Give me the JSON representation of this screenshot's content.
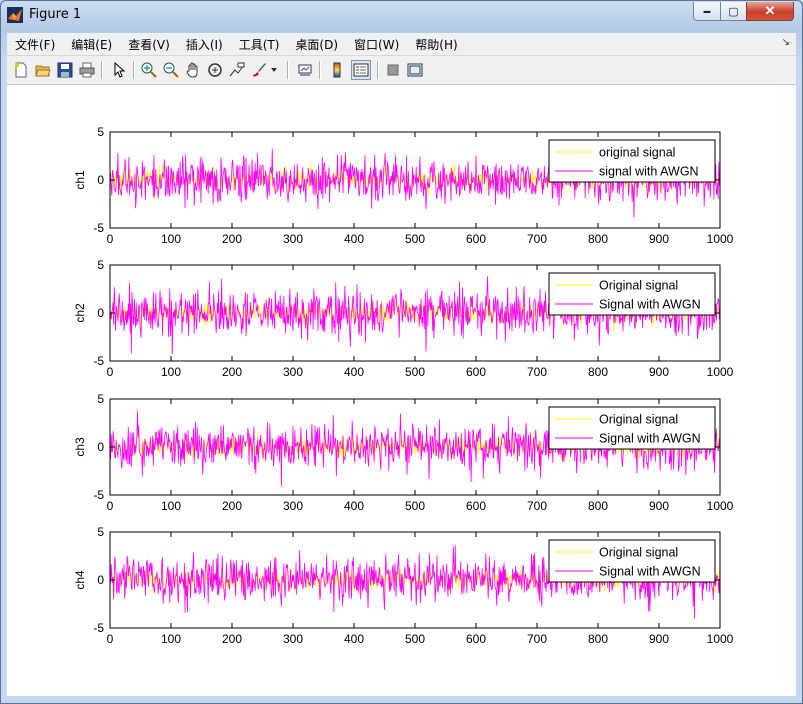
{
  "window": {
    "title": "Figure 1"
  },
  "window_controls": {
    "minimize": "▬",
    "maximize": "▢",
    "close": "✕"
  },
  "menu": [
    "文件(F)",
    "编辑(E)",
    "查看(V)",
    "插入(I)",
    "工具(T)",
    "桌面(D)",
    "窗口(W)",
    "帮助(H)"
  ],
  "toolbar": {
    "icons": [
      "new-figure-icon",
      "open-file-icon",
      "save-icon",
      "print-icon",
      "pointer-arrow-icon",
      "zoom-in-icon",
      "zoom-out-icon",
      "pan-hand-icon",
      "rotate-3d-icon",
      "data-cursor-icon",
      "brush-icon",
      "brush-dropdown-icon",
      "link-plot-icon",
      "colorbar-icon",
      "legend-icon",
      "hide-plot-tools-icon",
      "show-plot-tools-icon"
    ]
  },
  "colors": {
    "original": "#ffff00",
    "noisy": "#ff00ff",
    "frame": "#000000"
  },
  "chart_data": [
    {
      "type": "line",
      "ylabel": "ch1",
      "xlim": [
        0,
        1000
      ],
      "ylim": [
        -5,
        5
      ],
      "xticks": [
        0,
        100,
        200,
        300,
        400,
        500,
        600,
        700,
        800,
        900,
        1000
      ],
      "yticks": [
        -5,
        0,
        5
      ],
      "legend_position": "top-right",
      "series": [
        {
          "name": "original signal",
          "color": "#ffff00",
          "amplitude_std": 0.6
        },
        {
          "name": "signal with AWGN",
          "color": "#ff00ff",
          "amplitude_std": 1.2
        }
      ]
    },
    {
      "type": "line",
      "ylabel": "ch2",
      "xlim": [
        0,
        1000
      ],
      "ylim": [
        -5,
        5
      ],
      "xticks": [
        0,
        100,
        200,
        300,
        400,
        500,
        600,
        700,
        800,
        900,
        1000
      ],
      "yticks": [
        -5,
        0,
        5
      ],
      "legend_position": "top-right",
      "series": [
        {
          "name": "Original signal",
          "color": "#ffff00",
          "amplitude_std": 0.6
        },
        {
          "name": "Signal with AWGN",
          "color": "#ff00ff",
          "amplitude_std": 1.2
        }
      ]
    },
    {
      "type": "line",
      "ylabel": "ch3",
      "xlim": [
        0,
        1000
      ],
      "ylim": [
        -5,
        5
      ],
      "xticks": [
        0,
        100,
        200,
        300,
        400,
        500,
        600,
        700,
        800,
        900,
        1000
      ],
      "yticks": [
        -5,
        0,
        5
      ],
      "legend_position": "top-right",
      "series": [
        {
          "name": "Original signal",
          "color": "#ffff00",
          "amplitude_std": 0.6
        },
        {
          "name": "Signal with AWGN",
          "color": "#ff00ff",
          "amplitude_std": 1.2
        }
      ]
    },
    {
      "type": "line",
      "ylabel": "ch4",
      "xlim": [
        0,
        1000
      ],
      "ylim": [
        -5,
        5
      ],
      "xticks": [
        0,
        100,
        200,
        300,
        400,
        500,
        600,
        700,
        800,
        900,
        1000
      ],
      "yticks": [
        -5,
        0,
        5
      ],
      "legend_position": "top-right",
      "series": [
        {
          "name": "Original signal",
          "color": "#ffff00",
          "amplitude_std": 0.6
        },
        {
          "name": "Signal with AWGN",
          "color": "#ff00ff",
          "amplitude_std": 1.2
        }
      ]
    }
  ]
}
